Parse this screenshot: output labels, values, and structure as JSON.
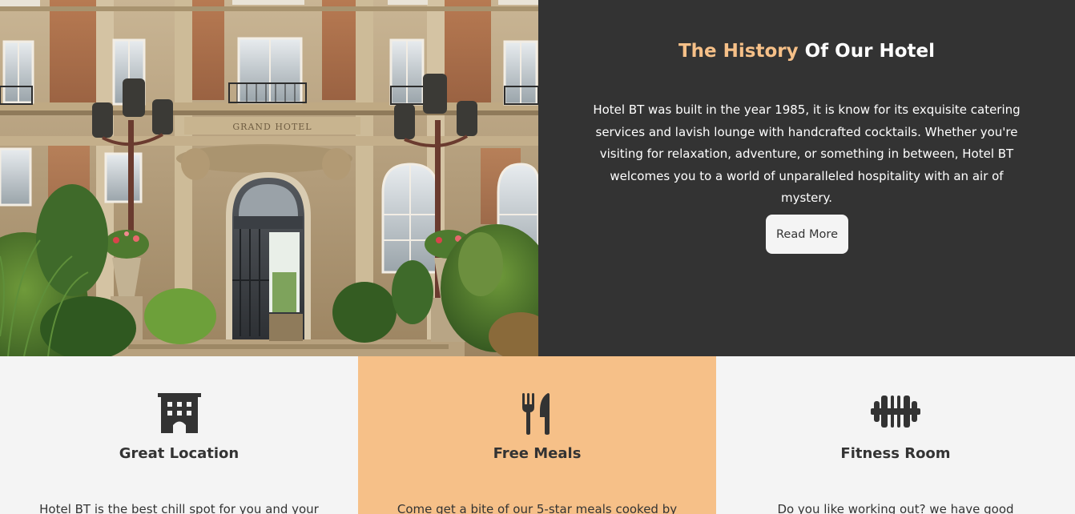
{
  "history": {
    "title_accent": "The History",
    "title_rest": " Of Our Hotel",
    "text": "Hotel BT was built in the year 1985, it is know for its exquisite catering services and lavish lounge with handcrafted cocktails. Whether you're visiting for relaxation, adventure, or something in between, Hotel BT welcomes you to a world of unparalleled hospitality with an air of mystery.",
    "button_label": "Read More"
  },
  "photo": {
    "facade_sign": "GRAND HOTEL"
  },
  "features": [
    {
      "icon": "building-icon",
      "title": "Great Location",
      "text": "Hotel BT is the best chill spot for you and your"
    },
    {
      "icon": "utensils-icon",
      "title": "Free Meals",
      "text": "Come get a bite of our 5-star meals cooked by"
    },
    {
      "icon": "dumbbell-icon",
      "title": "Fitness Room",
      "text": "Do you like working out? we have good"
    }
  ],
  "colors": {
    "dark_panel": "#333333",
    "accent": "#f6c088",
    "light_panel": "#f4f4f4",
    "icon": "#333333"
  }
}
